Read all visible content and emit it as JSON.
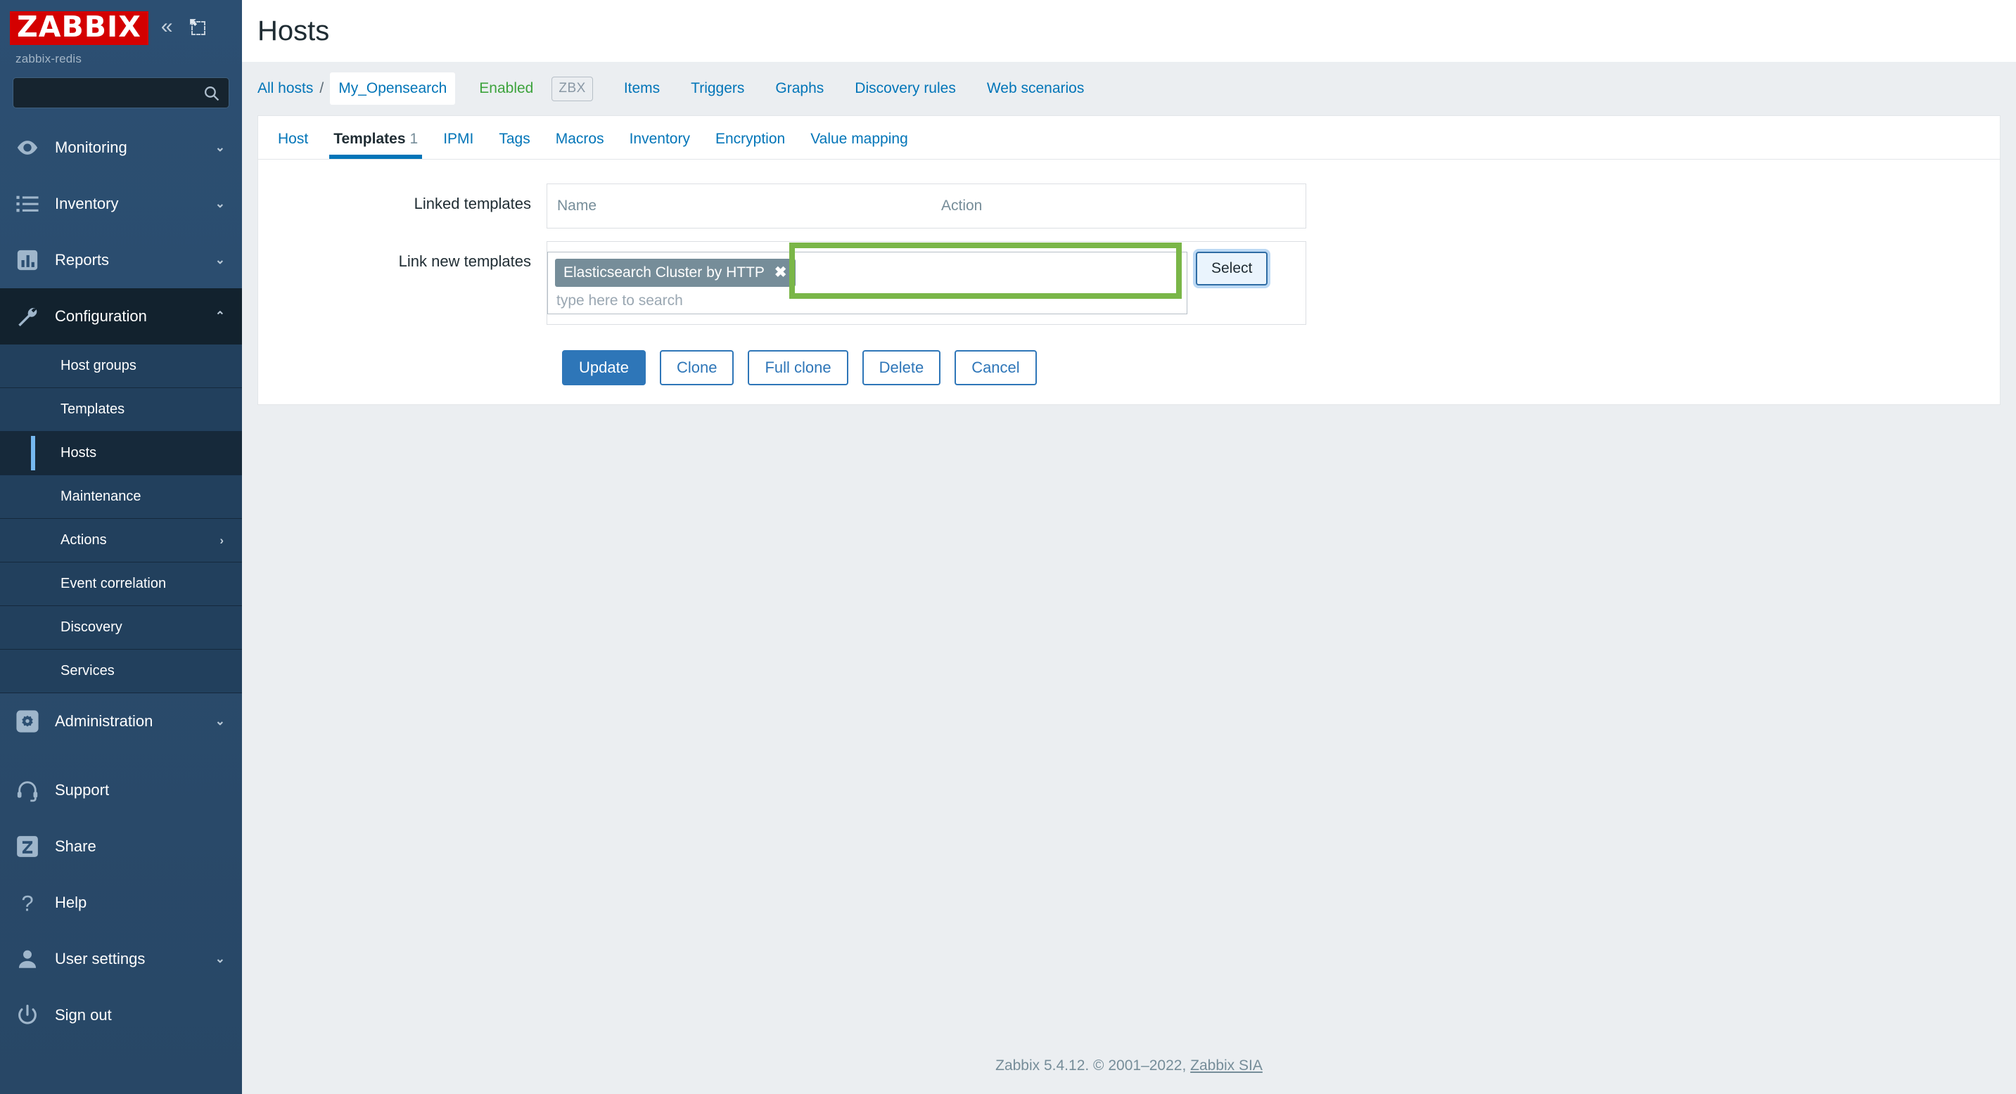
{
  "sidebar": {
    "logo_text": "ZABBIX",
    "collapse_icon": "chevron-double-left-icon",
    "hide_icon": "collapse-sidebar-icon",
    "server_name": "zabbix-redis",
    "search_placeholder": "",
    "search_value": "",
    "search_icon": "search-icon",
    "nav": [
      {
        "label": "Monitoring",
        "icon": "eye-icon",
        "chevron": "⌄",
        "expanded": false
      },
      {
        "label": "Inventory",
        "icon": "list-icon",
        "chevron": "⌄",
        "expanded": false
      },
      {
        "label": "Reports",
        "icon": "bar-chart-icon",
        "chevron": "⌄",
        "expanded": false
      },
      {
        "label": "Configuration",
        "icon": "wrench-icon",
        "chevron": "⌃",
        "expanded": true
      }
    ],
    "sub_items": [
      {
        "label": "Host groups",
        "active": false,
        "chevron": ""
      },
      {
        "label": "Templates",
        "active": false,
        "chevron": ""
      },
      {
        "label": "Hosts",
        "active": true,
        "chevron": ""
      },
      {
        "label": "Maintenance",
        "active": false,
        "chevron": ""
      },
      {
        "label": "Actions",
        "active": false,
        "chevron": "›"
      },
      {
        "label": "Event correlation",
        "active": false,
        "chevron": ""
      },
      {
        "label": "Discovery",
        "active": false,
        "chevron": ""
      },
      {
        "label": "Services",
        "active": false,
        "chevron": ""
      }
    ],
    "admin": {
      "label": "Administration",
      "icon": "gear-icon",
      "chevron": "⌄"
    },
    "lower": [
      {
        "label": "Support",
        "icon": "headset-icon",
        "chevron": ""
      },
      {
        "label": "Share",
        "icon": "zabbix-z-icon",
        "chevron": ""
      },
      {
        "label": "Help",
        "icon": "question-mark-icon",
        "chevron": ""
      },
      {
        "label": "User settings",
        "icon": "user-icon",
        "chevron": "⌄"
      },
      {
        "label": "Sign out",
        "icon": "power-icon",
        "chevron": ""
      }
    ]
  },
  "header": {
    "title": "Hosts"
  },
  "breadcrumb": {
    "all_hosts": "All hosts",
    "separator": "/",
    "host_name": "My_Opensearch",
    "status": "Enabled",
    "zbx_badge": "ZBX",
    "links": [
      "Items",
      "Triggers",
      "Graphs",
      "Discovery rules",
      "Web scenarios"
    ]
  },
  "tabs": [
    {
      "label": "Host",
      "count": "",
      "active": false
    },
    {
      "label": "Templates",
      "count": "1",
      "active": true
    },
    {
      "label": "IPMI",
      "count": "",
      "active": false
    },
    {
      "label": "Tags",
      "count": "",
      "active": false
    },
    {
      "label": "Macros",
      "count": "",
      "active": false
    },
    {
      "label": "Inventory",
      "count": "",
      "active": false
    },
    {
      "label": "Encryption",
      "count": "",
      "active": false
    },
    {
      "label": "Value mapping",
      "count": "",
      "active": false
    }
  ],
  "form": {
    "linked_templates_label": "Linked templates",
    "table_headers": {
      "name": "Name",
      "action": "Action"
    },
    "link_new_label": "Link new templates",
    "selected_templates": [
      {
        "name": "Elasticsearch Cluster by HTTP",
        "remove_icon": "✖"
      }
    ],
    "search_placeholder": "type here to search",
    "search_value": "",
    "select_button": "Select"
  },
  "buttons": {
    "update": "Update",
    "clone": "Clone",
    "full_clone": "Full clone",
    "delete": "Delete",
    "cancel": "Cancel"
  },
  "footer": {
    "text": "Zabbix 5.4.12. © 2001–2022,",
    "link": "Zabbix SIA"
  },
  "colors": {
    "accent_blue": "#2e76b8",
    "link_blue": "#0275b8",
    "sidebar_bg": "#2c4f72",
    "logo_red": "#d40000",
    "status_green": "#3da33d",
    "highlight_green": "#7ab648",
    "chip_gray": "#768d99"
  }
}
